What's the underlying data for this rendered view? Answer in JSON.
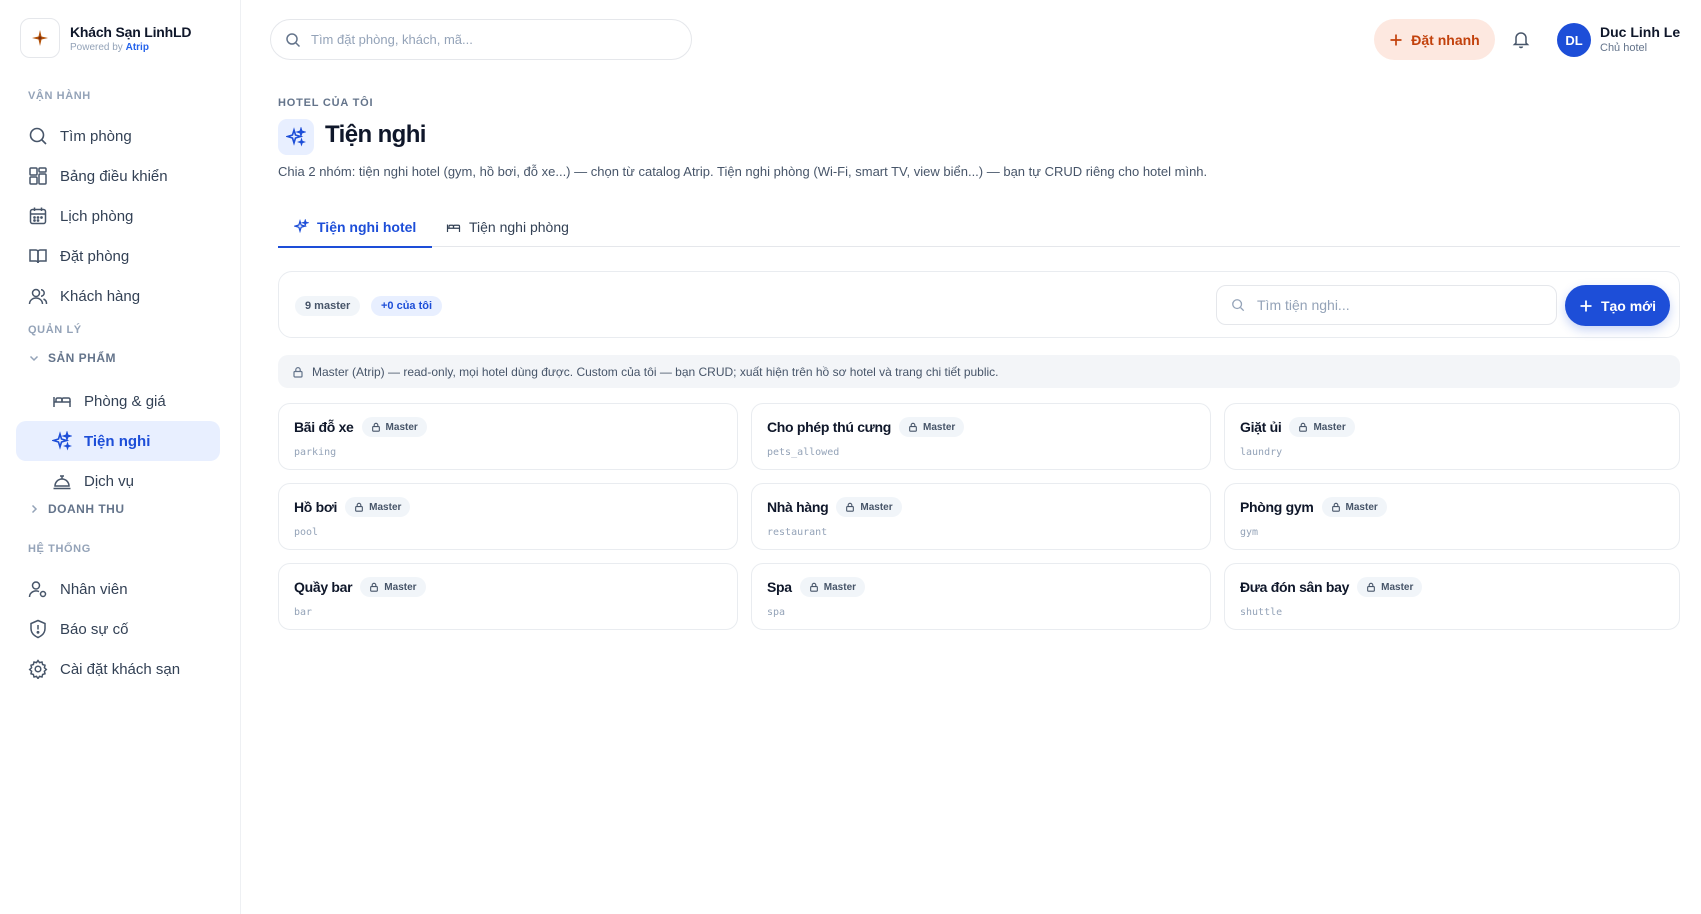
{
  "brand": {
    "name": "Khách Sạn LinhLD",
    "powered_prefix": "Powered by",
    "powered_brand": "Atrip"
  },
  "sidebar": {
    "section_ops": "VẬN HÀNH",
    "ops_items": [
      {
        "label": "Tìm phòng",
        "icon": "search-icon"
      },
      {
        "label": "Bảng điều khiển",
        "icon": "dashboard-icon"
      },
      {
        "label": "Lịch phòng",
        "icon": "calendar-icon"
      },
      {
        "label": "Đặt phòng",
        "icon": "book-icon"
      },
      {
        "label": "Khách hàng",
        "icon": "users-icon"
      }
    ],
    "section_mgmt": "QUẢN LÝ",
    "group_products": "SẢN PHẨM",
    "product_items": [
      {
        "label": "Phòng & giá",
        "icon": "bed-icon"
      },
      {
        "label": "Tiện nghi",
        "icon": "sparkles-icon"
      },
      {
        "label": "Dịch vụ",
        "icon": "service-bell-icon"
      }
    ],
    "group_revenue": "DOANH THU",
    "section_system": "HỆ THỐNG",
    "system_items": [
      {
        "label": "Nhân viên",
        "icon": "staff-icon"
      },
      {
        "label": "Báo sự cố",
        "icon": "shield-icon"
      },
      {
        "label": "Cài đặt khách sạn",
        "icon": "gear-icon"
      }
    ]
  },
  "header": {
    "search_placeholder": "Tìm đặt phòng, khách, mã...",
    "quick_booking": "Đặt nhanh",
    "avatar_initials": "DL",
    "user_name": "Duc Linh Le",
    "user_role": "Chủ hotel"
  },
  "page": {
    "eyebrow": "HOTEL CỦA TÔI",
    "title": "Tiện nghi",
    "description": "Chia 2 nhóm: tiện nghi hotel (gym, hồ bơi, đỗ xe...) — chọn từ catalog Atrip. Tiện nghi phòng (Wi-Fi, smart TV, view biển...) — bạn tự CRUD riêng cho hotel mình."
  },
  "tabs": [
    {
      "label": "Tiện nghi hotel",
      "active": true
    },
    {
      "label": "Tiện nghi phòng",
      "active": false
    }
  ],
  "toolbar": {
    "count_master": "9 master",
    "count_mine": "+0 của tôi",
    "search_placeholder": "Tìm tiện nghi...",
    "create_label": "Tạo mới"
  },
  "banner": "Master (Atrip) — read-only, mọi hotel dùng được. Custom của tôi — bạn CRUD; xuất hiện trên hồ sơ hotel và trang chi tiết public.",
  "amenities": [
    {
      "name": "Bãi đỗ xe",
      "badge": "Master",
      "code": "parking"
    },
    {
      "name": "Cho phép thú cưng",
      "badge": "Master",
      "code": "pets_allowed"
    },
    {
      "name": "Giặt ủi",
      "badge": "Master",
      "code": "laundry"
    },
    {
      "name": "Hồ bơi",
      "badge": "Master",
      "code": "pool"
    },
    {
      "name": "Nhà hàng",
      "badge": "Master",
      "code": "restaurant"
    },
    {
      "name": "Phòng gym",
      "badge": "Master",
      "code": "gym"
    },
    {
      "name": "Quầy bar",
      "badge": "Master",
      "code": "bar"
    },
    {
      "name": "Spa",
      "badge": "Master",
      "code": "spa"
    },
    {
      "name": "Đưa đón sân bay",
      "badge": "Master",
      "code": "shuttle"
    }
  ],
  "colors": {
    "accent": "#1d4ed8",
    "quick_bg": "#fde8e0",
    "quick_text": "#c2410c",
    "active_bg": "#e8efff"
  }
}
